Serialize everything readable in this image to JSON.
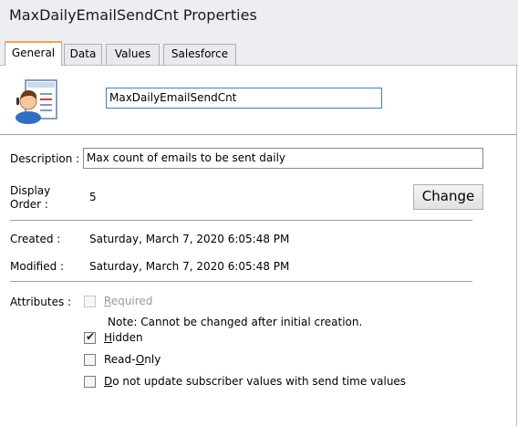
{
  "window": {
    "title": "MaxDailyEmailSendCnt Properties"
  },
  "tabs": [
    {
      "label": "General",
      "active": true
    },
    {
      "label": "Data",
      "active": false
    },
    {
      "label": "Values",
      "active": false
    },
    {
      "label": "Salesforce",
      "active": false
    }
  ],
  "general": {
    "icon": "attribute-user-icon",
    "name_value": "MaxDailyEmailSendCnt",
    "description_label": "Description :",
    "description_value": "Max count of emails to be sent daily",
    "display_order_label_1": "Display",
    "display_order_label_2": "Order :",
    "display_order_value": "5",
    "change_button": "Change",
    "created_label": "Created :",
    "created_value": "Saturday, March 7, 2020 6:05:48 PM",
    "modified_label": "Modified :",
    "modified_value": "Saturday, March 7, 2020 6:05:48 PM",
    "attributes_label": "Attributes :",
    "required": {
      "label": "Required",
      "checked": false,
      "disabled": true
    },
    "note": "Note: Cannot be changed after initial creation.",
    "hidden": {
      "label": "Hidden",
      "checked": true
    },
    "read_only": {
      "label": "Read-Only",
      "checked": false
    },
    "no_update": {
      "label": "Do not update subscriber values with send time values",
      "checked": false
    }
  },
  "colors": {
    "tab_accent": "#f0a64b",
    "focus_border": "#3c7fd1",
    "chrome_bg": "#eceef1"
  }
}
